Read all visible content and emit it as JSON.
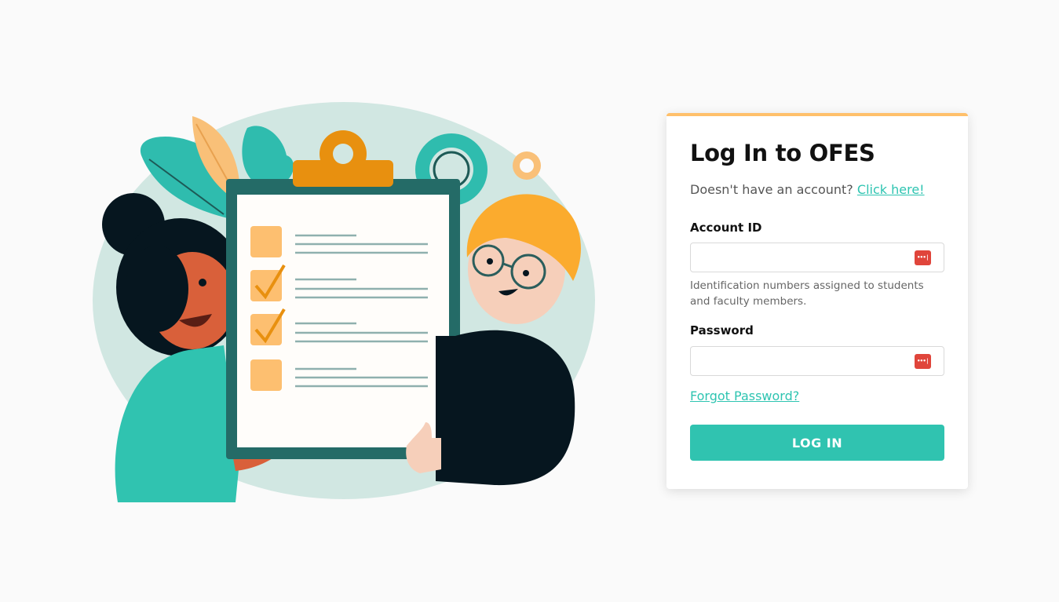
{
  "login": {
    "title": "Log In to OFES",
    "signup_prompt": "Doesn't have an account?",
    "signup_link": "Click here!",
    "account_label": "Account ID",
    "account_value": "",
    "account_helper": "Identification numbers assigned to students and faculty members.",
    "password_label": "Password",
    "password_value": "",
    "password_manager_icon": "password-manager-icon",
    "forgot_link": "Forgot Password?",
    "submit_label": "LOG IN"
  },
  "colors": {
    "accent": "#30c3b0",
    "link": "#2ec4b1",
    "card_top_border": "#ffc06b",
    "icon_red": "#e0453b"
  },
  "illustration": {
    "subject": "two people holding a checklist clipboard"
  }
}
